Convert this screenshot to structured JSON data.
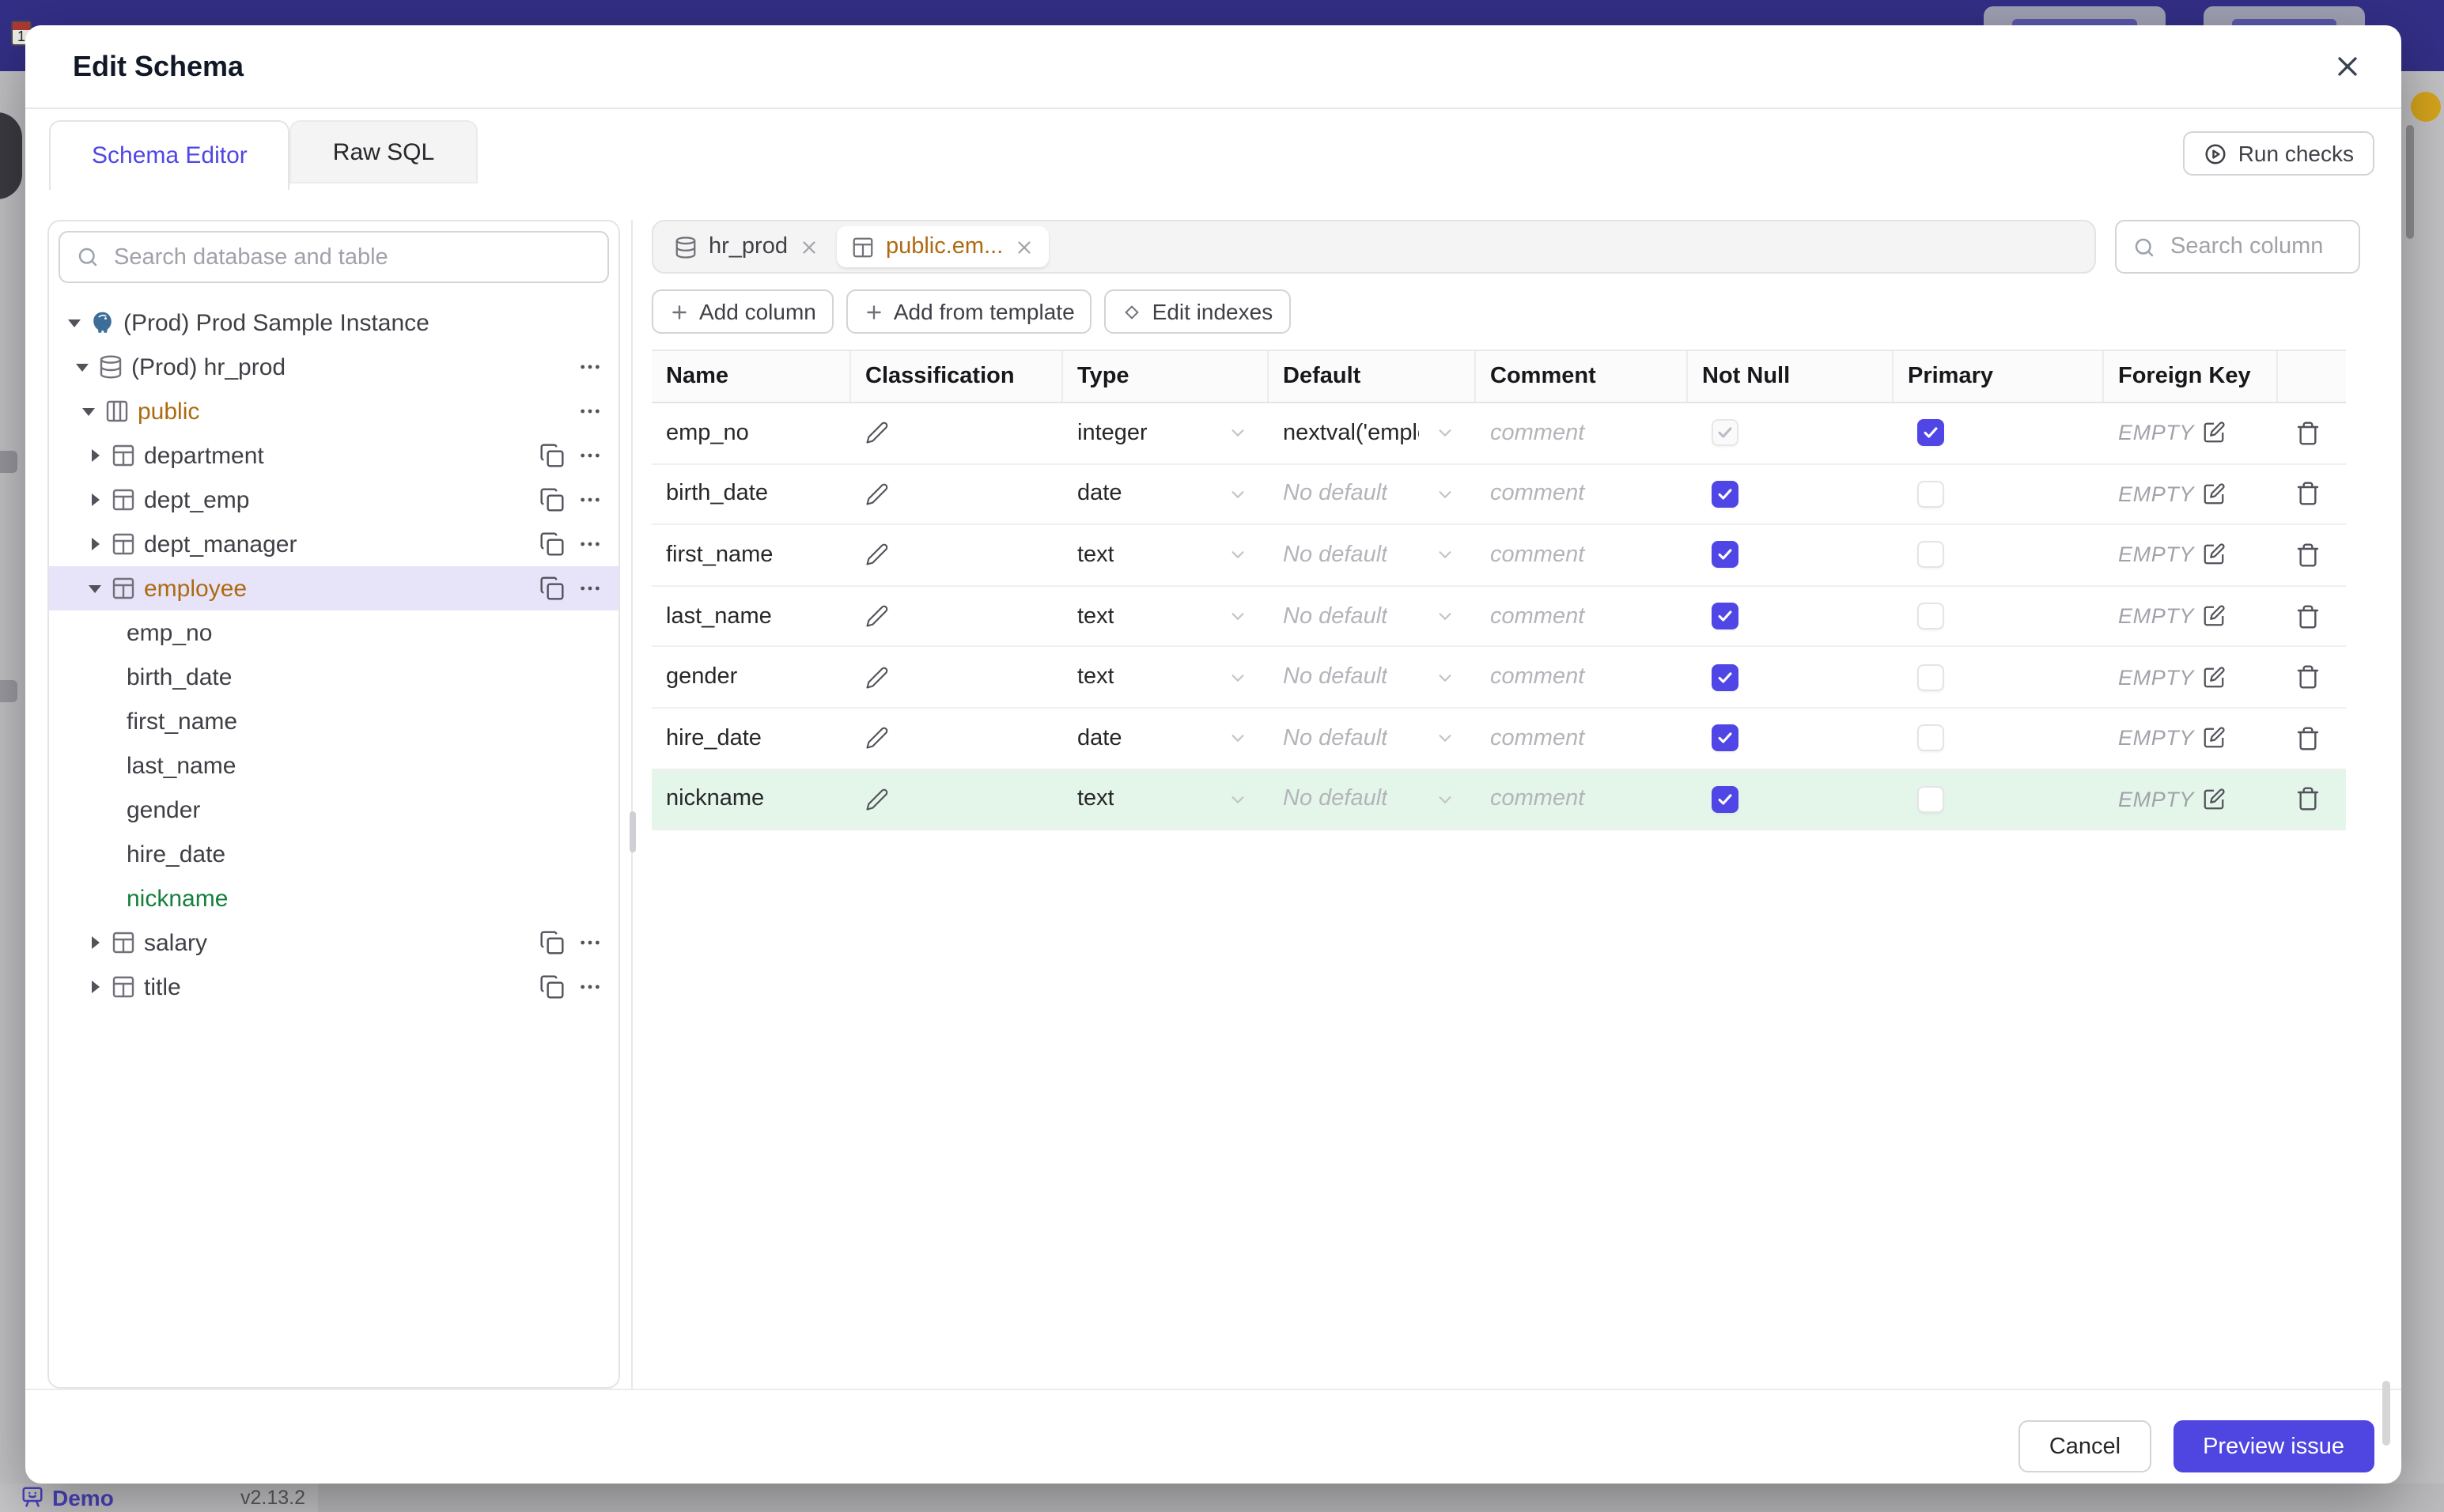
{
  "underlying_page": {
    "demo_label": "Demo",
    "version": "v2.13.2"
  },
  "colors": {
    "accent": "#4f46e5",
    "modified_amber": "#ad6a10",
    "added_green": "#15803d",
    "added_row_bg": "#e4f5e9",
    "selected_row_bg": "#e7e4fa",
    "primary_button": "#4f45e0"
  },
  "modal": {
    "title": "Edit Schema",
    "tabs": [
      {
        "label": "Schema Editor",
        "active": true
      },
      {
        "label": "Raw SQL",
        "active": false
      }
    ],
    "run_checks_label": "Run checks",
    "sidebar": {
      "search_placeholder": "Search database and table",
      "tree": [
        {
          "depth": 0,
          "caret": "down",
          "icon": "postgresql",
          "label": "(Prod) Prod Sample Instance",
          "actions": []
        },
        {
          "depth": 1,
          "caret": "down",
          "icon": "database",
          "label": "(Prod) hr_prod",
          "actions": [
            "more"
          ]
        },
        {
          "depth": 2,
          "caret": "down",
          "icon": "schema",
          "label": "public",
          "color": "amber",
          "actions": [
            "more"
          ]
        },
        {
          "depth": 3,
          "caret": "right",
          "icon": "table",
          "label": "department",
          "actions": [
            "copy",
            "more"
          ]
        },
        {
          "depth": 3,
          "caret": "right",
          "icon": "table",
          "label": "dept_emp",
          "actions": [
            "copy",
            "more"
          ]
        },
        {
          "depth": 3,
          "caret": "right",
          "icon": "table",
          "label": "dept_manager",
          "actions": [
            "copy",
            "more"
          ]
        },
        {
          "depth": 3,
          "caret": "down",
          "icon": "table",
          "label": "employee",
          "color": "amber",
          "selected": true,
          "actions": [
            "copy",
            "more"
          ]
        },
        {
          "depth": 4,
          "label": "emp_no"
        },
        {
          "depth": 4,
          "label": "birth_date"
        },
        {
          "depth": 4,
          "label": "first_name"
        },
        {
          "depth": 4,
          "label": "last_name"
        },
        {
          "depth": 4,
          "label": "gender"
        },
        {
          "depth": 4,
          "label": "hire_date"
        },
        {
          "depth": 4,
          "label": "nickname",
          "color": "green"
        },
        {
          "depth": 3,
          "caret": "right",
          "icon": "table",
          "label": "salary",
          "actions": [
            "copy",
            "more"
          ]
        },
        {
          "depth": 3,
          "caret": "right",
          "icon": "table",
          "label": "title",
          "actions": [
            "copy",
            "more"
          ]
        }
      ]
    },
    "editor": {
      "open_tabs": [
        {
          "icon": "database",
          "label": "hr_prod",
          "active": false
        },
        {
          "icon": "table",
          "label": "public.em...",
          "active": true,
          "modified": true
        }
      ],
      "column_search_placeholder": "Search column",
      "toolbar": [
        {
          "icon": "plus",
          "label": "Add column"
        },
        {
          "icon": "plus",
          "label": "Add from template"
        },
        {
          "icon": "diamond",
          "label": "Edit indexes"
        }
      ],
      "table": {
        "headers": [
          "Name",
          "Classification",
          "Type",
          "Default",
          "Comment",
          "Not Null",
          "Primary",
          "Foreign Key",
          ""
        ],
        "no_default_label": "No default",
        "comment_placeholder": "comment",
        "fk_empty_label": "EMPTY",
        "rows": [
          {
            "name": "emp_no",
            "type": "integer",
            "default": "nextval('employ",
            "not_null": "disabled-checked",
            "primary": true,
            "added": false
          },
          {
            "name": "birth_date",
            "type": "date",
            "default": null,
            "not_null": "checked",
            "primary": false,
            "added": false
          },
          {
            "name": "first_name",
            "type": "text",
            "default": null,
            "not_null": "checked",
            "primary": false,
            "added": false
          },
          {
            "name": "last_name",
            "type": "text",
            "default": null,
            "not_null": "checked",
            "primary": false,
            "added": false
          },
          {
            "name": "gender",
            "type": "text",
            "default": null,
            "not_null": "checked",
            "primary": false,
            "added": false
          },
          {
            "name": "hire_date",
            "type": "date",
            "default": null,
            "not_null": "checked",
            "primary": false,
            "added": false
          },
          {
            "name": "nickname",
            "type": "text",
            "default": null,
            "not_null": "checked",
            "primary": false,
            "added": true
          }
        ]
      }
    },
    "footer": {
      "cancel_label": "Cancel",
      "submit_label": "Preview issue"
    }
  }
}
